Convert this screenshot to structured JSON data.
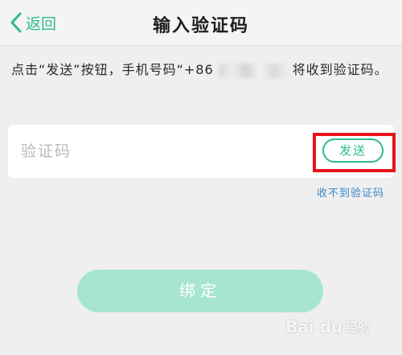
{
  "header": {
    "back_label": "返回",
    "title": "输入验证码"
  },
  "hint": {
    "prefix": "点击“发送”按钮，手机号码“+86",
    "suffix": "将收到验证码。"
  },
  "form": {
    "code_placeholder": "验证码",
    "send_label": "发送",
    "no_code_link": "收不到验证码"
  },
  "actions": {
    "bind_label": "绑定"
  },
  "watermark": {
    "logo_text": "Bai du",
    "sub_text": "经验"
  },
  "colors": {
    "accent": "#2dbb8a",
    "highlight": "#e8141b",
    "link": "#3b86c7",
    "bind_disabled": "#a7e5d1"
  }
}
